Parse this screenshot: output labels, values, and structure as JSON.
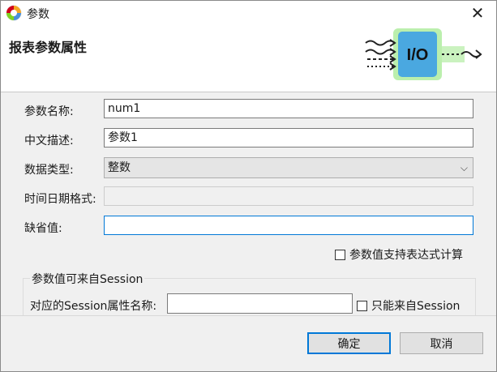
{
  "window": {
    "title": "参数"
  },
  "header": {
    "title": "报表参数属性",
    "graphic_text": "I/O"
  },
  "form": {
    "name_label": "参数名称:",
    "name_value": "num1",
    "desc_label": "中文描述:",
    "desc_value": "参数1",
    "type_label": "数据类型:",
    "type_value": "整数",
    "datetime_label": "时间日期格式:",
    "datetime_value": "",
    "default_label": "缺省值:",
    "default_value": "",
    "expr_checkbox_label": "参数值支持表达式计算"
  },
  "session": {
    "group_title": "参数值可来自Session",
    "attr_label": "对应的Session属性名称:",
    "attr_value": "",
    "only_checkbox_label": "只能来自Session"
  },
  "buttons": {
    "ok": "确定",
    "cancel": "取消"
  },
  "colors": {
    "accent": "#0078d7",
    "io_box": "#4aa8e0",
    "io_glow": "#7ed957"
  }
}
